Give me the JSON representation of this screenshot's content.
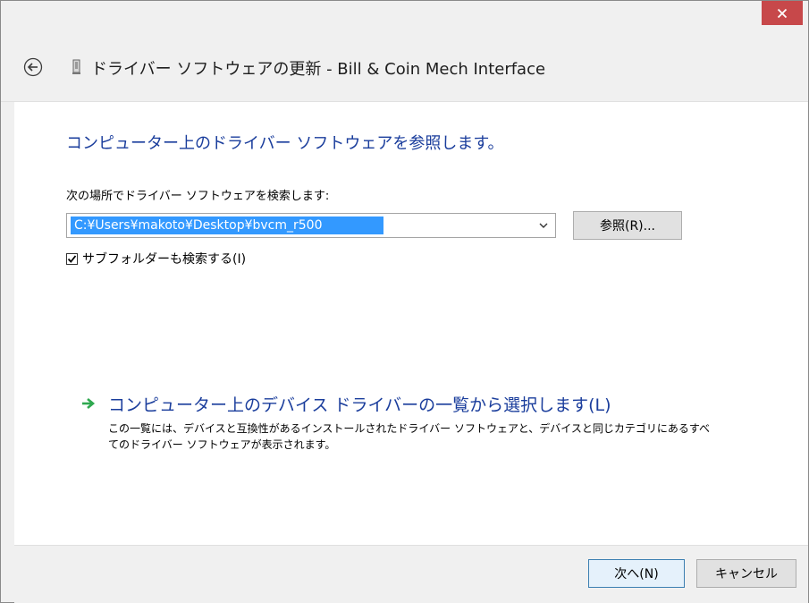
{
  "window": {
    "close_symbol": "✕"
  },
  "header": {
    "title": "ドライバー ソフトウェアの更新 - Bill & Coin Mech Interface",
    "back_icon": "back-arrow-circle-icon",
    "device_icon": "device-icon"
  },
  "main": {
    "heading": "コンピューター上のドライバー ソフトウェアを参照します。",
    "search_label": "次の場所でドライバー ソフトウェアを検索します:",
    "path_value": "C:¥Users¥makoto¥Desktop¥bvcm_r500",
    "browse_label": "参照(R)...",
    "subfolder_label": "サブフォルダーも検索する(I)",
    "subfolder_checked": true,
    "pick_title": "コンピューター上のデバイス ドライバーの一覧から選択します(L)",
    "pick_desc": "この一覧には、デバイスと互換性があるインストールされたドライバー ソフトウェアと、デバイスと同じカテゴリにあるすべてのドライバー ソフトウェアが表示されます。"
  },
  "footer": {
    "next_label": "次へ(N)",
    "cancel_label": "キャンセル"
  },
  "colors": {
    "accent_blue": "#1a3d9c",
    "close_red": "#c7484a",
    "selection_blue": "#3399ff",
    "arrow_green": "#2fa84f"
  }
}
